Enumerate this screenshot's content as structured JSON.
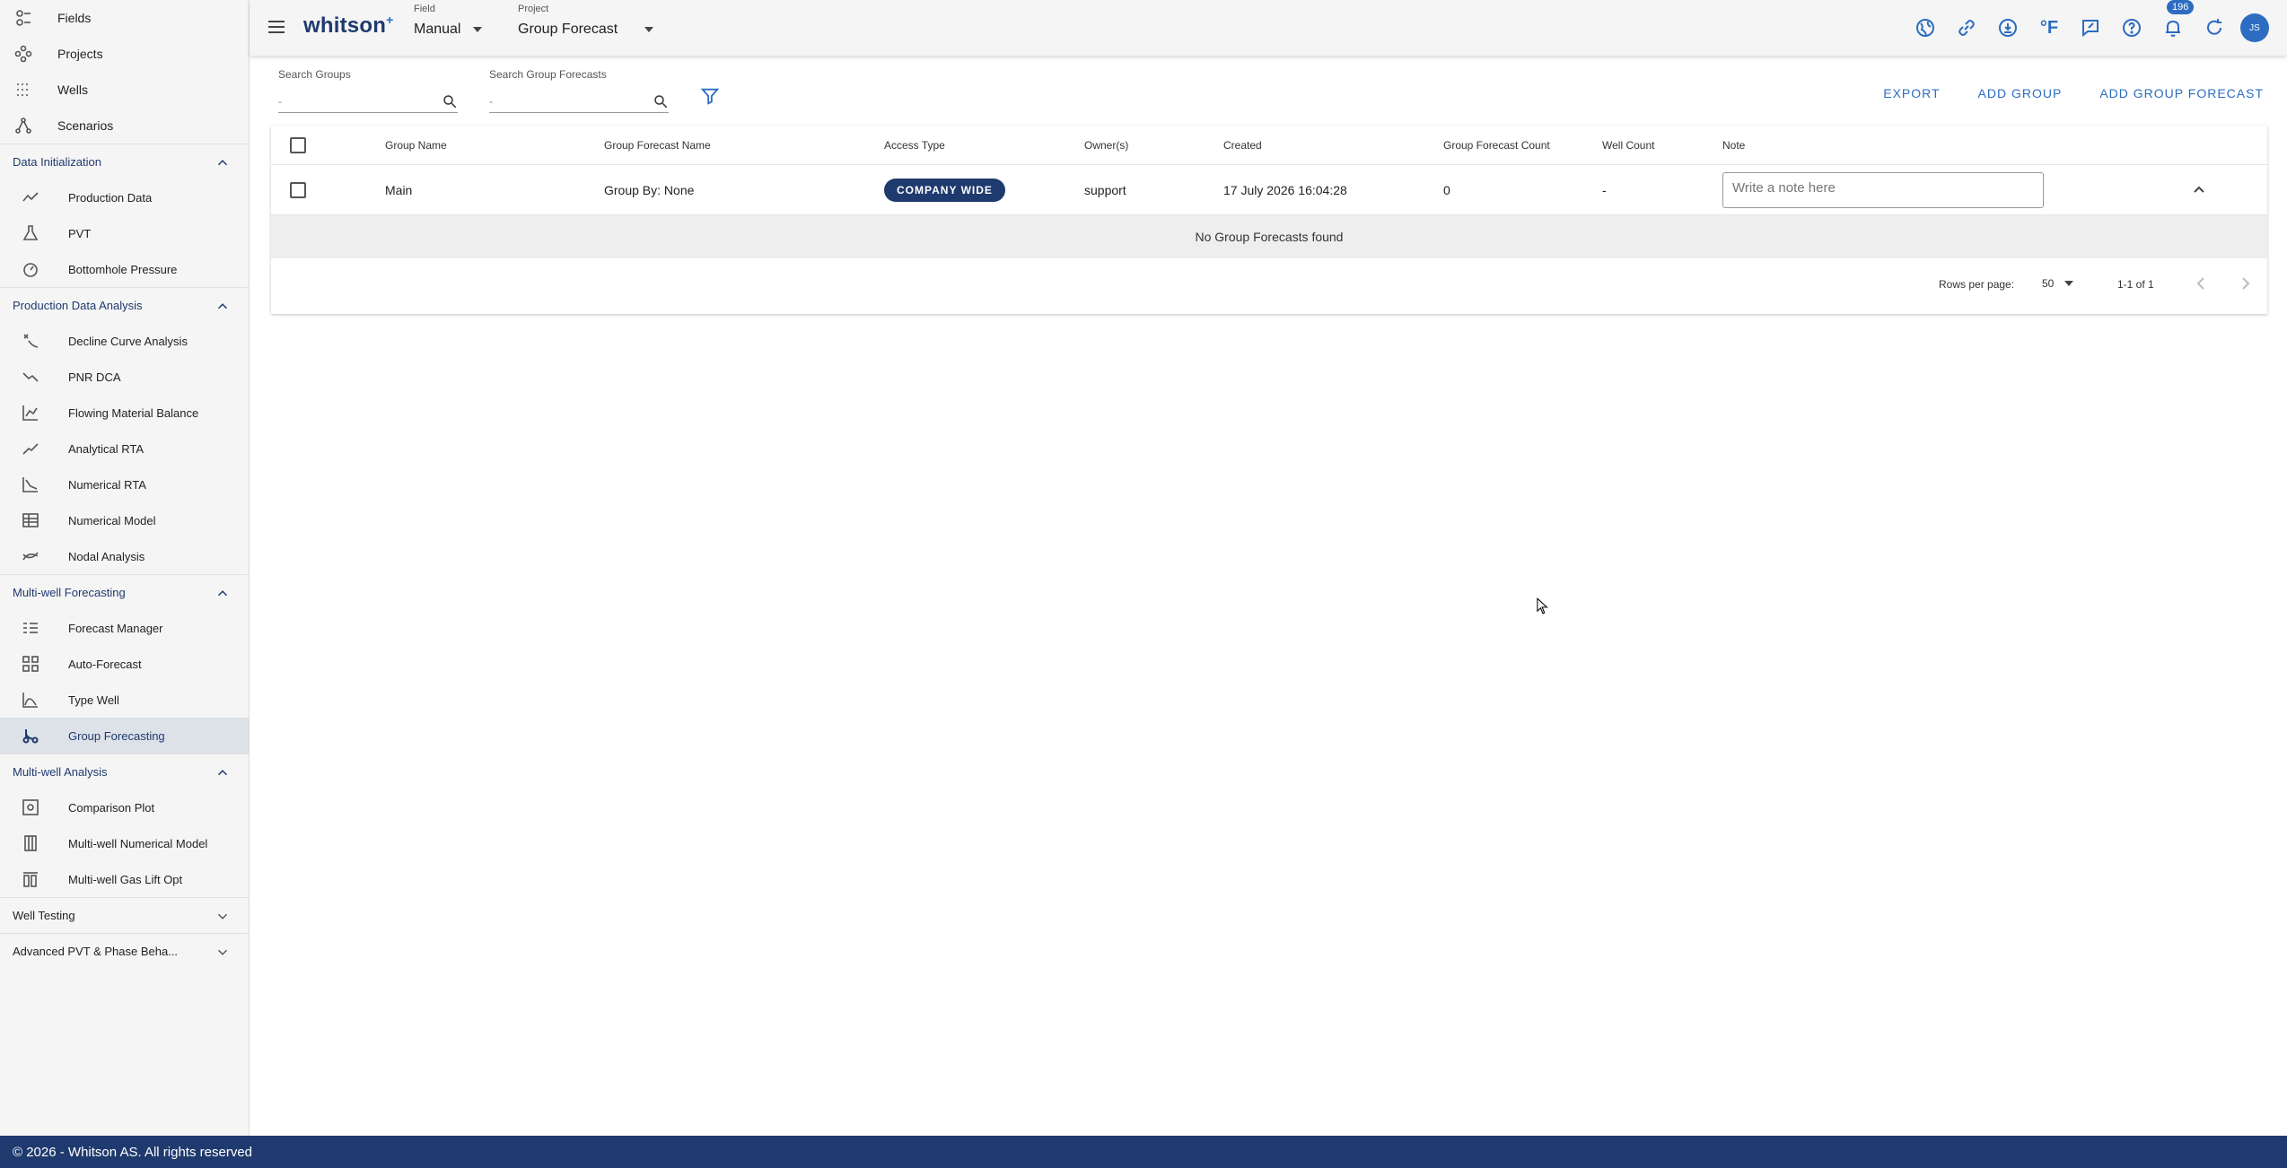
{
  "sidebar": {
    "top_items": [
      {
        "label": "Fields",
        "icon": "fields-icon"
      },
      {
        "label": "Projects",
        "icon": "projects-icon"
      },
      {
        "label": "Wells",
        "icon": "wells-icon"
      },
      {
        "label": "Scenarios",
        "icon": "scenarios-icon"
      }
    ],
    "sections": [
      {
        "title": "Data Initialization",
        "expanded": true,
        "items": [
          "Production Data",
          "PVT",
          "Bottomhole Pressure"
        ]
      },
      {
        "title": "Production Data Analysis",
        "expanded": true,
        "items": [
          "Decline Curve Analysis",
          "PNR DCA",
          "Flowing Material Balance",
          "Analytical RTA",
          "Numerical RTA",
          "Numerical Model",
          "Nodal Analysis"
        ]
      },
      {
        "title": "Multi-well Forecasting",
        "expanded": true,
        "items": [
          "Forecast Manager",
          "Auto-Forecast",
          "Type Well",
          "Group Forecasting"
        ]
      },
      {
        "title": "Multi-well Analysis",
        "expanded": true,
        "items": [
          "Comparison Plot",
          "Multi-well Numerical Model",
          "Multi-well Gas Lift Opt"
        ]
      },
      {
        "title": "Well Testing",
        "expanded": false,
        "items": []
      },
      {
        "title": "Advanced PVT & Phase Beha...",
        "expanded": false,
        "items": []
      }
    ],
    "active_item": "Group Forecasting"
  },
  "header": {
    "logo_text": "whitson",
    "logo_sup": "+",
    "field_label": "Field",
    "field_value": "Manual",
    "project_label": "Project",
    "project_value": "Group Forecast",
    "temp_unit": "°F",
    "notification_count": "196",
    "avatar_initials": "JS"
  },
  "search": {
    "groups_label": "Search Groups",
    "groups_placeholder": "-",
    "forecasts_label": "Search Group Forecasts",
    "forecasts_placeholder": "-"
  },
  "actions": {
    "export": "EXPORT",
    "add_group": "ADD GROUP",
    "add_group_forecast": "ADD GROUP FORECAST"
  },
  "table": {
    "columns": [
      "Group Name",
      "Group Forecast Name",
      "Access Type",
      "Owner(s)",
      "Created",
      "Group Forecast Count",
      "Well Count",
      "Note"
    ],
    "rows": [
      {
        "group_name": "Main",
        "group_forecast_name": "Group By: None",
        "access_type": "COMPANY WIDE",
        "owners": "support",
        "created": "17 July 2026 16:04:28",
        "group_forecast_count": "0",
        "well_count": "-",
        "note_placeholder": "Write a note here"
      }
    ],
    "empty_message": "No Group Forecasts found",
    "rows_per_page_label": "Rows per page:",
    "rows_per_page_value": "50",
    "page_range": "1-1 of 1"
  },
  "footer": {
    "copyright": "© 2026 - Whitson AS. All rights reserved"
  },
  "colors": {
    "brand_navy": "#1f3a6e",
    "accent_blue": "#2d6cc0"
  }
}
